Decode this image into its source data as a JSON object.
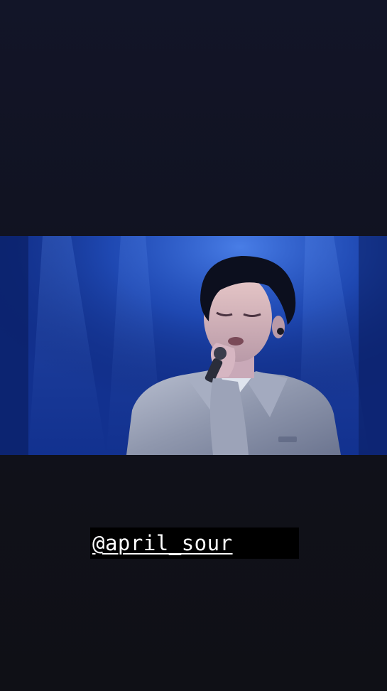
{
  "story": {
    "mention": "@april_sour"
  },
  "colors": {
    "background_top": "#121528",
    "background_bottom": "#0f1016",
    "stage_blue": "#1a49b8",
    "mention_text": "#ffffff",
    "mention_bg": "#000000"
  }
}
